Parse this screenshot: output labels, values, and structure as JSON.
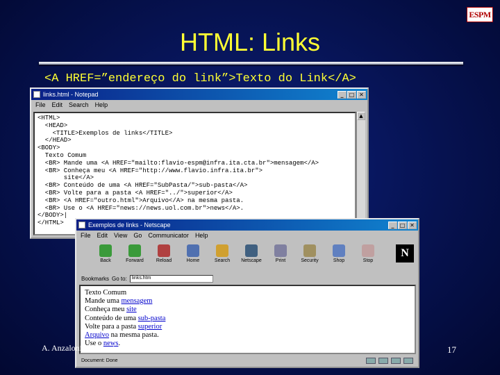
{
  "logo": {
    "text": "ESPM"
  },
  "slide": {
    "title": "HTML: Links",
    "code_line": "<A HREF=”endereço do link”>Texto do Link</A>",
    "footer": "A. Anzaloni, C. Nascimento, F. Mendes, D. Magri",
    "page_number": "17"
  },
  "notepad": {
    "title": "links.html - Notepad",
    "menu": [
      "File",
      "Edit",
      "Search",
      "Help"
    ],
    "content": "<HTML>\n  <HEAD>\n    <TITLE>Exemplos de links</TITLE>\n  </HEAD>\n<BODY>\n  Texto Comum\n  <BR> Mande uma <A HREF=\"mailto:flavio-espm@infra.ita.cta.br\">mensagem</A>\n  <BR> Conheça meu <A HREF=\"http://www.flavio.infra.ita.br\">\n       site</A>\n  <BR> Conteúdo de uma <A HREF=\"SubPasta/\">sub-pasta</A>\n  <BR> Volte para a pasta <A HREF=\"../\">superior</A>\n  <BR> <A HREF=\"outro.html\">Arquivo</A> na mesma pasta.\n  <BR> Use o <A HREF=\"news://news.uol.com.br\">news</A>.\n</BODY>|\n</HTML>"
  },
  "netscape": {
    "title": "Exemplos de links - Netscape",
    "menu": [
      "File",
      "Edit",
      "View",
      "Go",
      "Communicator",
      "Help"
    ],
    "toolbar": [
      "Back",
      "Forward",
      "Reload",
      "Home",
      "Search",
      "Netscape",
      "Print",
      "Security",
      "Shop",
      "Stop"
    ],
    "logo_letter": "N",
    "bookmarks_label": "Bookmarks",
    "goto_label": "Go to:",
    "location": "links.htm",
    "page": {
      "line1": "Texto Comum",
      "line2_prefix": "Mande uma ",
      "line2_link": "mensagem",
      "line3_prefix": "Conheça meu ",
      "line3_link": "site",
      "line4_prefix": "Conteúdo de uma ",
      "line4_link": "sub-pasta",
      "line5_prefix": "Volte para a pasta ",
      "line5_link": "superior",
      "line6_link": "Arquivo",
      "line6_suffix": " na mesma pasta.",
      "line7_prefix": "Use o ",
      "line7_link": "news",
      "line7_suffix": "."
    },
    "status": "Document: Done"
  },
  "colors": {
    "background": "#061250",
    "title": "#ffff33",
    "logo_red": "#b00000",
    "link": "#0000cc"
  }
}
